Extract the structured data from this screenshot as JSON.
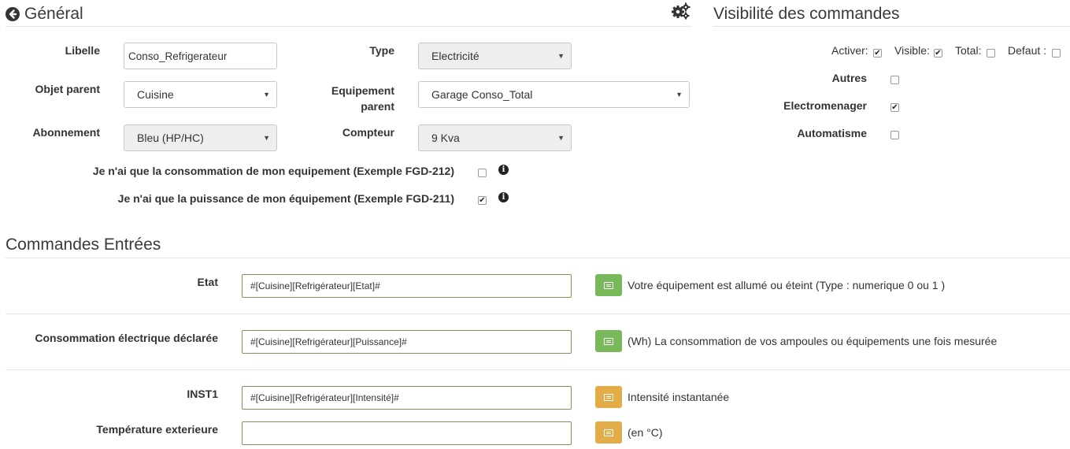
{
  "general": {
    "title": "Général",
    "back_icon": "arrow-circle-left-icon",
    "config_icon": "gears-icon",
    "libelle_label": "Libelle",
    "libelle_value": "Conso_Refrigerateur",
    "type_label": "Type",
    "type_value": "Electricité",
    "objet_parent_label": "Objet parent",
    "objet_parent_value": "Cuisine",
    "equipement_parent_label_1": "Equipement",
    "equipement_parent_label_2": "parent",
    "equipement_parent_value": "Garage Conso_Total",
    "abonnement_label": "Abonnement",
    "abonnement_value": "Bleu (HP/HC)",
    "compteur_label": "Compteur",
    "compteur_value": "9 Kva",
    "conso_only_label": "Je n'ai que la consommation de mon equipement (Exemple FGD-212)",
    "conso_only_checked": false,
    "puissance_only_label": "Je n'ai que la puissance de mon équipement (Exemple FGD-211)",
    "puissance_only_checked": true
  },
  "visibility": {
    "title": "Visibilité des commandes",
    "activer_label": "Activer:",
    "activer_checked": true,
    "visible_label": "Visible:",
    "visible_checked": true,
    "total_label": "Total:",
    "total_checked": false,
    "defaut_label": "Defaut :",
    "defaut_checked": false,
    "categories": [
      {
        "label": "Autres",
        "checked": false
      },
      {
        "label": "Electromenager",
        "checked": true
      },
      {
        "label": "Automatisme",
        "checked": false
      }
    ]
  },
  "commandes": {
    "title": "Commandes Entrées",
    "rows": [
      {
        "label": "Etat",
        "value": "#[Cuisine][Refrigérateur][Etat]#",
        "button_color": "green",
        "description": "Votre équipement est allumé ou éteint (Type : numerique 0 ou 1 )"
      },
      {
        "label": "Consommation électrique déclarée",
        "value": "#[Cuisine][Refrigérateur][Puissance]#",
        "button_color": "green",
        "description": "(Wh) La consommation de vos ampoules ou équipements une fois mesurée"
      },
      {
        "label": "INST1",
        "value": "#[Cuisine][Refrigérateur][Intensité]#",
        "button_color": "yellow",
        "description": "Intensité instantanée"
      },
      {
        "label": "Température exterieure",
        "value": "",
        "button_color": "yellow",
        "description": "(en °C)"
      }
    ]
  },
  "colors": {
    "green_button": "#7ab95b",
    "yellow_button": "#e2ac48"
  }
}
